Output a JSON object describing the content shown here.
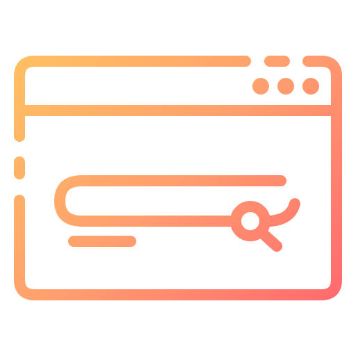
{
  "icon": {
    "name": "browser-search-icon",
    "description_parts": [
      "browser-window-frame",
      "window-control-dots",
      "search-bar",
      "magnifier-icon",
      "text-line"
    ],
    "colors": {
      "gradient_start": "#FFC95E",
      "gradient_mid": "#FF9E6E",
      "gradient_end": "#FF5C6E",
      "background": "#FFFFFF"
    },
    "window_control_dot_count": 3
  }
}
